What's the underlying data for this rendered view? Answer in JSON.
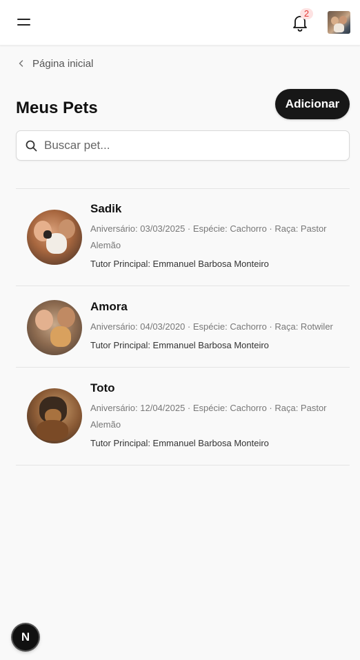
{
  "header": {
    "notification_count": "2"
  },
  "breadcrumb": {
    "label": "Página inicial"
  },
  "page": {
    "title": "Meus Pets",
    "add_label": "Adicionar"
  },
  "search": {
    "placeholder": "Buscar pet...",
    "value": ""
  },
  "pets": [
    {
      "name": "Sadik",
      "details": "Aniversário: 03/03/2025 · Espécie: Cachorro · Raça: Pastor Alemão",
      "tutor": "Tutor Principal: Emmanuel Barbosa Monteiro"
    },
    {
      "name": "Amora",
      "details": "Aniversário: 04/03/2020 · Espécie: Cachorro · Raça: Rotwiler",
      "tutor": "Tutor Principal: Emmanuel Barbosa Monteiro"
    },
    {
      "name": "Toto",
      "details": "Aniversário: 12/04/2025 · Espécie: Cachorro · Raça: Pastor Alemão",
      "tutor": "Tutor Principal: Emmanuel Barbosa Monteiro"
    }
  ],
  "fab": {
    "label": "N"
  },
  "colors": {
    "primary_button": "#171717",
    "badge_bg": "#fde2e2",
    "badge_text": "#e53935",
    "background": "#f9f9f9"
  },
  "icons": {
    "menu": "menu-icon",
    "notifications": "bell-icon",
    "back": "chevron-left-icon",
    "search": "search-icon"
  }
}
